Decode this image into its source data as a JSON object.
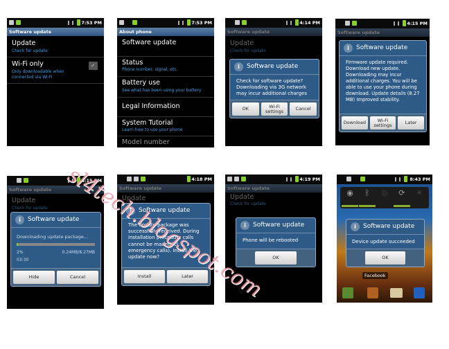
{
  "status_times": [
    "7:53 PM",
    "7:53 PM",
    "4:14 PM",
    "4:15 PM",
    "4:15 PM",
    "4:18 PM",
    "4:19 PM",
    "8:43 PM"
  ],
  "software_update_title": "Software update",
  "screen1": {
    "items": [
      {
        "title": "Update",
        "sub": "Check for update"
      },
      {
        "title": "Wi-Fi only",
        "sub1": "Only downloadable when",
        "sub2": "connected via Wi-Fi",
        "checked": true
      }
    ]
  },
  "screen2": {
    "title": "About phone",
    "items": [
      {
        "title": "Software update"
      },
      {
        "title": "Status",
        "sub": "Phone number, signal, etc."
      },
      {
        "title": "Battery use",
        "sub": "See what has been using your battery"
      },
      {
        "title": "Legal Information"
      },
      {
        "title": "System Tutorial",
        "sub": "Learn how to use your phone"
      },
      {
        "title": "Model number"
      }
    ]
  },
  "screen3": {
    "bg_title": "Update",
    "bg_sub": "Check for update",
    "dialog": {
      "title": "Software update",
      "body": "Check for software update? Downloading via 3G network may incur additional charges",
      "buttons": [
        "OK",
        "Wi-Fi settings",
        "Cancel"
      ]
    }
  },
  "screen4": {
    "dialog": {
      "title": "Software update",
      "body": "Firmware update required. Download new update. Downloading may incur additional charges. You will be able to use your phone during download. Update details (8.27 MB) Improved stability.",
      "buttons": [
        "Download",
        "Wi-Fi settings",
        "Later"
      ]
    }
  },
  "screen5": {
    "bg_title": "Update",
    "bg_sub": "Check for update",
    "dialog": {
      "title": "Software update",
      "message": "Downloading update package...",
      "progress_percent": 2,
      "percent_label": "2%",
      "size_label": "0.24MB/8.27MB",
      "time_label": "03:30",
      "buttons": [
        "Hide",
        "Cancel"
      ]
    }
  },
  "screen6": {
    "bg_title": "Update",
    "dialog": {
      "title": "Software update",
      "body": "The update package was successfully received. During installation procedure calls cannot be made(incl. emergency calls). Install the update now?",
      "buttons": [
        "Install",
        "Later"
      ]
    }
  },
  "screen7": {
    "bg_title": "Update",
    "bg_sub": "Check for update",
    "dialog": {
      "title": "Software update",
      "body": "Phone will be rebooted",
      "buttons": [
        "OK"
      ]
    }
  },
  "screen8": {
    "dialog": {
      "title": "Software update",
      "body": "Device update succeeded",
      "buttons": [
        "OK"
      ]
    },
    "home_label": "Facebook"
  },
  "watermark": "sl4tech.blogspot.com",
  "colors": {
    "title_bar": "#2f5580",
    "dialog": "#2d5a86",
    "subtext": "#3fa0e8"
  }
}
